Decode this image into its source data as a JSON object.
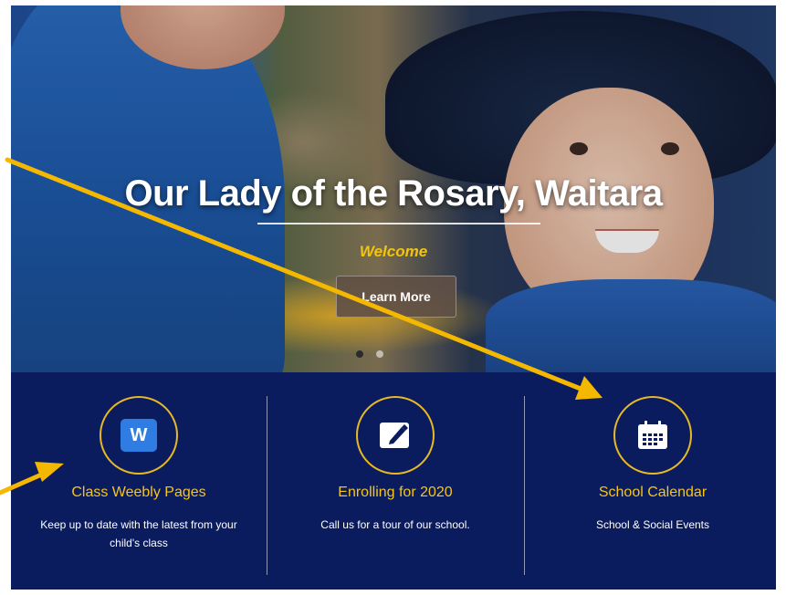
{
  "hero": {
    "title": "Our Lady of the Rosary, Waitara",
    "welcome": "Welcome",
    "button_label": "Learn More",
    "slides": 2,
    "active_slide": 1
  },
  "features": [
    {
      "icon": "weebly-icon",
      "title": "Class Weebly Pages",
      "text": "Keep up to date with the latest from your child's class"
    },
    {
      "icon": "pencil-edit-icon",
      "title": "Enrolling for 2020",
      "text": "Call us for a tour of our school."
    },
    {
      "icon": "calendar-icon",
      "title": "School Calendar",
      "text": "School & Social Events"
    }
  ],
  "colors": {
    "band": "#0b1c5e",
    "accent": "#f5c518",
    "arrow": "#f5b800"
  }
}
